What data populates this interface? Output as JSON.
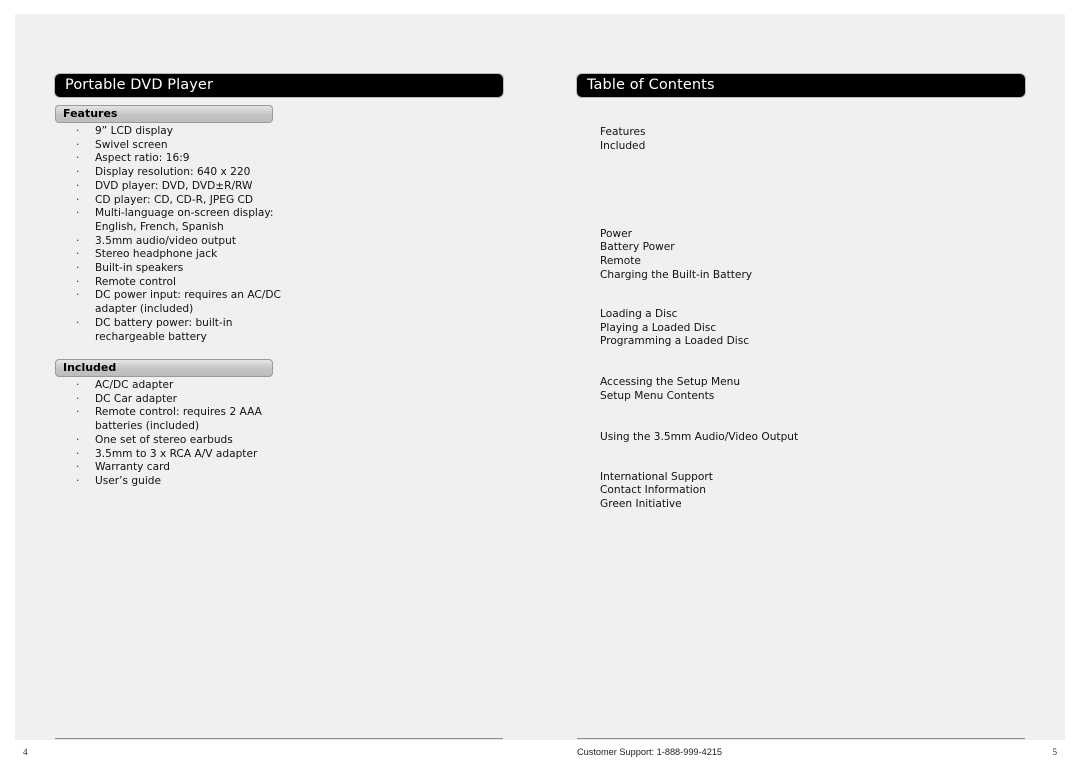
{
  "document": {
    "background_color": "#f0f0f0",
    "accent_color": "#000000"
  },
  "left_page": {
    "title": "Portable DVD Player",
    "folio": "4",
    "sections": [
      {
        "heading": "Features",
        "items": [
          "9” LCD display",
          "Swivel screen",
          "Aspect ratio: 16:9",
          "Display resolution: 640 x 220",
          "DVD player: DVD, DVD±R/RW",
          "CD player: CD, CD-R, JPEG CD",
          "Multi-language on-screen display:\nEnglish, French, Spanish",
          "3.5mm audio/video output",
          "Stereo headphone jack",
          "Built-in speakers",
          "Remote control",
          "DC power input: requires an AC/DC\nadapter (included)",
          "DC battery power: built-in\nrechargeable battery"
        ]
      },
      {
        "heading": "Included",
        "items": [
          "AC/DC adapter",
          "DC Car adapter",
          "Remote control: requires 2 AAA\nbatteries (included)",
          "One set of stereo earbuds",
          "3.5mm to 3 x RCA A/V adapter",
          "Warranty card",
          "User’s guide"
        ]
      }
    ],
    "bullet_glyph": "·"
  },
  "right_page": {
    "title": "Table of Contents",
    "folio": "5",
    "support_text": "Customer Support: 1-888-999-4215",
    "toc_groups": [
      {
        "entries": [
          "Features",
          "Included"
        ]
      },
      {
        "entries": [
          "Power",
          "Battery Power",
          "Remote",
          "Charging the Built-in Battery"
        ]
      },
      {
        "entries": [
          "Loading a Disc",
          "Playing a Loaded Disc",
          "Programming a Loaded Disc"
        ]
      },
      {
        "entries": [
          "Accessing the Setup Menu",
          "Setup Menu Contents"
        ]
      },
      {
        "entries": [
          "Using the 3.5mm Audio/Video Output"
        ]
      },
      {
        "entries": [
          "International Support",
          "Contact Information",
          "Green Initiative"
        ]
      }
    ]
  }
}
